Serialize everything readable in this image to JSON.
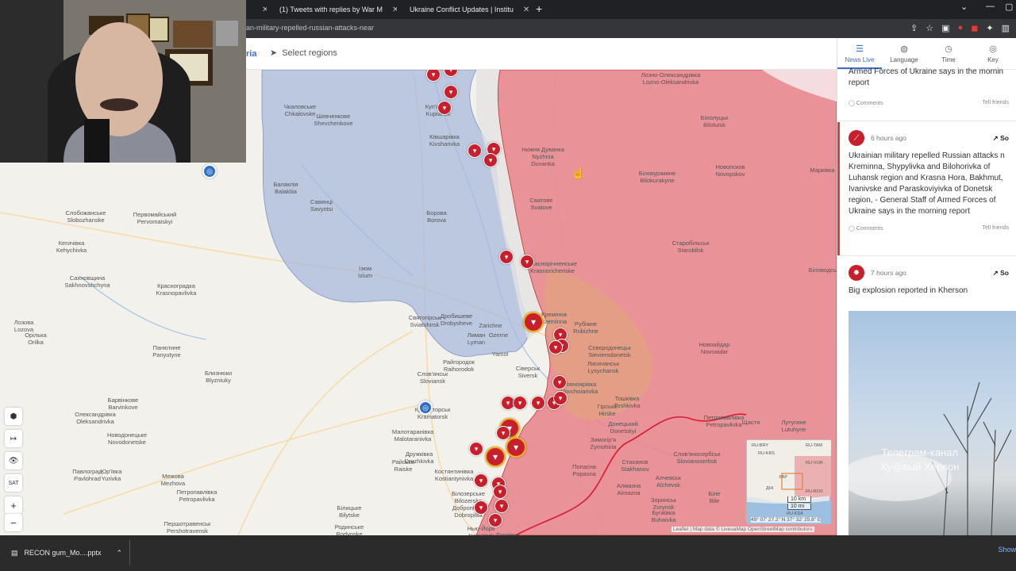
{
  "browser": {
    "tabs": [
      {
        "title": "(1) Tweets with replies by War M",
        "icon": "twitter-icon"
      },
      {
        "title": "Ukraine Conflict Updates | Institu",
        "icon": "isw-icon"
      }
    ],
    "url_fragment": "an-military-repelled-russian-attacks-near"
  },
  "mapbar": {
    "crumb": "ria",
    "select_label": "Select regions"
  },
  "panel": {
    "tabs": [
      {
        "label": "News Live",
        "icon": "list-icon"
      },
      {
        "label": "Language",
        "icon": "globe-icon"
      },
      {
        "label": "Time",
        "icon": "clock-icon"
      },
      {
        "label": "Key",
        "icon": "compass-icon"
      }
    ],
    "items": [
      {
        "time": "",
        "text": "Armed Forces of Ukraine says in the mornin report",
        "comments": "Comments",
        "tell": "Tell friends",
        "source": ""
      },
      {
        "time": "6 hours ago",
        "text": "Ukrainian military repelled Russian attacks n Kreminna, Shypylivka and Bilohorivka of Luhansk region and Krasna Hora, Bakhmut, Ivanivske and Paraskoviyivka of Donetsk region, - General Staff of Armed Forces of Ukraine says in the morning report",
        "comments": "Comments",
        "tell": "Tell friends",
        "source": "So"
      },
      {
        "time": "7 hours ago",
        "text": "Big explosion reported in Kherson",
        "source": "So"
      }
    ],
    "photo_caption": "Телеграм-канал\nХу@вый Херсон"
  },
  "map": {
    "cities": [
      {
        "t": "Чкаловське\nChkalovske"
      },
      {
        "t": "Шевченкове\nShevchenkove"
      },
      {
        "t": "Балаклія\nBalakliia"
      },
      {
        "t": "Савинці\nSavyntsi"
      },
      {
        "t": "Борова\nBorova"
      },
      {
        "t": "Ізюм\nIzium"
      },
      {
        "t": "Слобожанське\nSlobozhanske"
      },
      {
        "t": "Первомайський\nPervomaiskyi"
      },
      {
        "t": "Кегичівка\nKehychivka"
      },
      {
        "t": "Сахновщина\nSakhnovshchyna"
      },
      {
        "t": "Красноградка\nKrasnopavlivka"
      },
      {
        "t": "Лозова\nLozova"
      },
      {
        "t": "Орілька\nOrilka"
      },
      {
        "t": "Панютине\nPanyutyne"
      },
      {
        "t": "Близнюки\nBlyzniuky"
      },
      {
        "t": "Барвінкове\nBarvinkove"
      },
      {
        "t": "Олександрівка\nOleksandrivka"
      },
      {
        "t": "Новодонецьке\nNovodonetske"
      },
      {
        "t": "Павлоград\nPavlohrad"
      },
      {
        "t": "Юр'ївка\nYurivka"
      },
      {
        "t": "Межова\nMezhova"
      },
      {
        "t": "Петропавлівка\nPetropavlivka"
      },
      {
        "t": "Першотравенськ\nPershotravensk"
      },
      {
        "t": "Краматорськ\nKramatorsk"
      },
      {
        "t": "Слов'янськ\nSloviansk"
      },
      {
        "t": "Дробишеве\nDrobysheve"
      },
      {
        "t": "Лиман\nLyman"
      },
      {
        "t": "Святогірськ\nSviatohirsk"
      },
      {
        "t": "Райгородок\nRaihorodok"
      },
      {
        "t": "Сіверськ\nSiversk"
      },
      {
        "t": "Малотаранівка\nMalotaranivka"
      },
      {
        "t": "Дружківка\nDruzhkivka"
      },
      {
        "t": "Райське\nRaiske"
      },
      {
        "t": "Костянтинівка\nKostiantynivka"
      },
      {
        "t": "Білозерське\nBilozerske"
      },
      {
        "t": "Добропілля\nDobropillia"
      },
      {
        "t": "Білицьке\nBilytske"
      },
      {
        "t": "Родинське\nRodynske"
      },
      {
        "t": "Нью-Йорк\nNew York"
      },
      {
        "t": "Горлівка"
      },
      {
        "t": "Куп'янськ\nKupiansk"
      },
      {
        "t": "Ківшарівка\nKivsharivka"
      },
      {
        "t": "Нижня Дуванка\nNyzhnia\nDuvanka"
      },
      {
        "t": "Сватове\nSvatove"
      },
      {
        "t": "Краснорічненське\nKrasnorichenske"
      },
      {
        "t": "Кремінна\nKreminna"
      },
      {
        "t": "Рубіжне\nRubizhne"
      },
      {
        "t": "Сєвєродонецьк\nSievierodonetsk"
      },
      {
        "t": "Лисичанськ\nLysychansk"
      },
      {
        "t": "Вовчоярівка\nVovchoiarivka"
      },
      {
        "t": "Тошківка\nToshkivka"
      },
      {
        "t": "Гірське\nHirske"
      },
      {
        "t": "Донецький\nDonetskyi"
      },
      {
        "t": "Зимогір'я\nZymohiria"
      },
      {
        "t": "Попасна\nPopasna"
      },
      {
        "t": "Стаханов\nStakhanov"
      },
      {
        "t": "Алмазна\nAlmazna"
      },
      {
        "t": "Алчевськ\nAlchevsk"
      },
      {
        "t": "Зоринськ\nZorynsk"
      },
      {
        "t": "Бугаївка\nBuhaivka"
      },
      {
        "t": "Біле\nBile"
      },
      {
        "t": "Петропавлівка\nPetropavlivka"
      },
      {
        "t": "Слов'яносербськ\nSlovianoserbsk"
      },
      {
        "t": "Новоайдар\nNovoaidar"
      },
      {
        "t": "Старобільськ\nStarobilsk"
      },
      {
        "t": "Білокуракине\nBilokurakyne"
      },
      {
        "t": "Новопсков\nNovopskov"
      },
      {
        "t": "Білолуцьк\nBilolutsk"
      },
      {
        "t": "Лозно-Олександрівка\nLozno-Oleksandrivka"
      },
      {
        "t": "Біловодськ"
      },
      {
        "t": "Марківка"
      },
      {
        "t": "Щастя"
      },
      {
        "t": "Лутугине\nLutuhyne"
      },
      {
        "t": "Новосвітлівка\nNovosvitlivka"
      },
      {
        "t": "Yamol"
      },
      {
        "t": "Ozerne"
      },
      {
        "t": "Zarichne"
      }
    ],
    "controls": [
      "⬢",
      "↦",
      "👁",
      "SAT",
      "+",
      "−"
    ],
    "minimap_labels": [
      "RU-BRY",
      "RU-TAM",
      "RU-KRS",
      "RU-VOR",
      "RU-ROS",
      "RU-KDA",
      "ХАР",
      "ДНІ"
    ],
    "scale": [
      "10 km",
      "10 mi"
    ],
    "coords": "49° 07' 27.2\" N 37° 32' 25.8\" E",
    "attribution": "Leaflet | Map data © LiveuaMap OpenStreetMap contributors",
    "colors": {
      "occupied": "#e8878f",
      "liberated": "#a9b8dc",
      "contested": "#e0a878",
      "base": "#f3f1ec"
    }
  },
  "taskbar": {
    "download": "RECON gum_Mo....pptx",
    "show_all": "Show"
  }
}
